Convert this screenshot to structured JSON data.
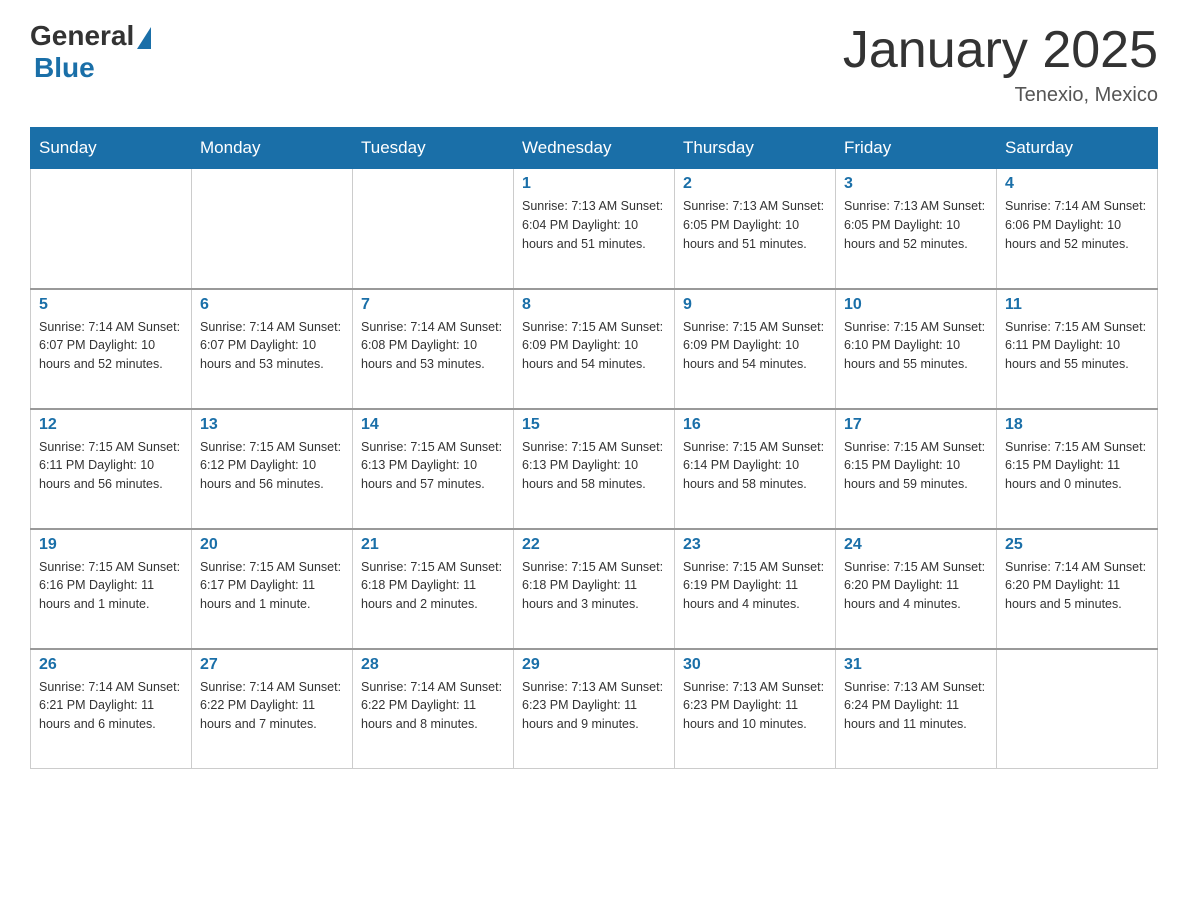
{
  "header": {
    "logo": {
      "general": "General",
      "blue": "Blue"
    },
    "title": "January 2025",
    "subtitle": "Tenexio, Mexico"
  },
  "days_of_week": [
    "Sunday",
    "Monday",
    "Tuesday",
    "Wednesday",
    "Thursday",
    "Friday",
    "Saturday"
  ],
  "weeks": [
    [
      {
        "day": "",
        "info": ""
      },
      {
        "day": "",
        "info": ""
      },
      {
        "day": "",
        "info": ""
      },
      {
        "day": "1",
        "info": "Sunrise: 7:13 AM\nSunset: 6:04 PM\nDaylight: 10 hours and 51 minutes."
      },
      {
        "day": "2",
        "info": "Sunrise: 7:13 AM\nSunset: 6:05 PM\nDaylight: 10 hours and 51 minutes."
      },
      {
        "day": "3",
        "info": "Sunrise: 7:13 AM\nSunset: 6:05 PM\nDaylight: 10 hours and 52 minutes."
      },
      {
        "day": "4",
        "info": "Sunrise: 7:14 AM\nSunset: 6:06 PM\nDaylight: 10 hours and 52 minutes."
      }
    ],
    [
      {
        "day": "5",
        "info": "Sunrise: 7:14 AM\nSunset: 6:07 PM\nDaylight: 10 hours and 52 minutes."
      },
      {
        "day": "6",
        "info": "Sunrise: 7:14 AM\nSunset: 6:07 PM\nDaylight: 10 hours and 53 minutes."
      },
      {
        "day": "7",
        "info": "Sunrise: 7:14 AM\nSunset: 6:08 PM\nDaylight: 10 hours and 53 minutes."
      },
      {
        "day": "8",
        "info": "Sunrise: 7:15 AM\nSunset: 6:09 PM\nDaylight: 10 hours and 54 minutes."
      },
      {
        "day": "9",
        "info": "Sunrise: 7:15 AM\nSunset: 6:09 PM\nDaylight: 10 hours and 54 minutes."
      },
      {
        "day": "10",
        "info": "Sunrise: 7:15 AM\nSunset: 6:10 PM\nDaylight: 10 hours and 55 minutes."
      },
      {
        "day": "11",
        "info": "Sunrise: 7:15 AM\nSunset: 6:11 PM\nDaylight: 10 hours and 55 minutes."
      }
    ],
    [
      {
        "day": "12",
        "info": "Sunrise: 7:15 AM\nSunset: 6:11 PM\nDaylight: 10 hours and 56 minutes."
      },
      {
        "day": "13",
        "info": "Sunrise: 7:15 AM\nSunset: 6:12 PM\nDaylight: 10 hours and 56 minutes."
      },
      {
        "day": "14",
        "info": "Sunrise: 7:15 AM\nSunset: 6:13 PM\nDaylight: 10 hours and 57 minutes."
      },
      {
        "day": "15",
        "info": "Sunrise: 7:15 AM\nSunset: 6:13 PM\nDaylight: 10 hours and 58 minutes."
      },
      {
        "day": "16",
        "info": "Sunrise: 7:15 AM\nSunset: 6:14 PM\nDaylight: 10 hours and 58 minutes."
      },
      {
        "day": "17",
        "info": "Sunrise: 7:15 AM\nSunset: 6:15 PM\nDaylight: 10 hours and 59 minutes."
      },
      {
        "day": "18",
        "info": "Sunrise: 7:15 AM\nSunset: 6:15 PM\nDaylight: 11 hours and 0 minutes."
      }
    ],
    [
      {
        "day": "19",
        "info": "Sunrise: 7:15 AM\nSunset: 6:16 PM\nDaylight: 11 hours and 1 minute."
      },
      {
        "day": "20",
        "info": "Sunrise: 7:15 AM\nSunset: 6:17 PM\nDaylight: 11 hours and 1 minute."
      },
      {
        "day": "21",
        "info": "Sunrise: 7:15 AM\nSunset: 6:18 PM\nDaylight: 11 hours and 2 minutes."
      },
      {
        "day": "22",
        "info": "Sunrise: 7:15 AM\nSunset: 6:18 PM\nDaylight: 11 hours and 3 minutes."
      },
      {
        "day": "23",
        "info": "Sunrise: 7:15 AM\nSunset: 6:19 PM\nDaylight: 11 hours and 4 minutes."
      },
      {
        "day": "24",
        "info": "Sunrise: 7:15 AM\nSunset: 6:20 PM\nDaylight: 11 hours and 4 minutes."
      },
      {
        "day": "25",
        "info": "Sunrise: 7:14 AM\nSunset: 6:20 PM\nDaylight: 11 hours and 5 minutes."
      }
    ],
    [
      {
        "day": "26",
        "info": "Sunrise: 7:14 AM\nSunset: 6:21 PM\nDaylight: 11 hours and 6 minutes."
      },
      {
        "day": "27",
        "info": "Sunrise: 7:14 AM\nSunset: 6:22 PM\nDaylight: 11 hours and 7 minutes."
      },
      {
        "day": "28",
        "info": "Sunrise: 7:14 AM\nSunset: 6:22 PM\nDaylight: 11 hours and 8 minutes."
      },
      {
        "day": "29",
        "info": "Sunrise: 7:13 AM\nSunset: 6:23 PM\nDaylight: 11 hours and 9 minutes."
      },
      {
        "day": "30",
        "info": "Sunrise: 7:13 AM\nSunset: 6:23 PM\nDaylight: 11 hours and 10 minutes."
      },
      {
        "day": "31",
        "info": "Sunrise: 7:13 AM\nSunset: 6:24 PM\nDaylight: 11 hours and 11 minutes."
      },
      {
        "day": "",
        "info": ""
      }
    ]
  ]
}
